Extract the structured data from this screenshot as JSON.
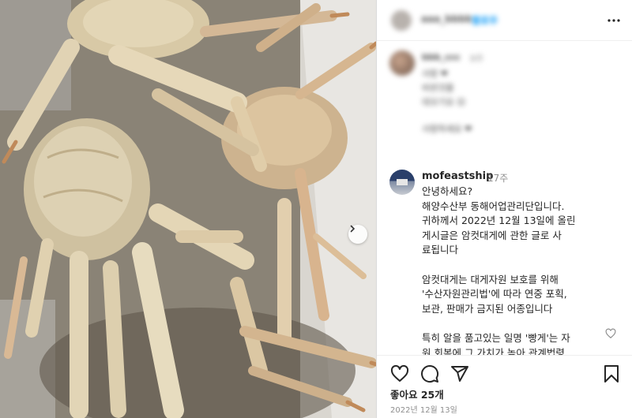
{
  "post": {
    "header": {
      "username": "aaa_bbbb",
      "follow_label": "팔로우"
    },
    "icons": {
      "more": "more-horizontal-icon",
      "next": "chevron-right-icon",
      "like": "heart-icon",
      "comment": "comment-icon",
      "share": "share-icon",
      "save": "bookmark-icon"
    },
    "blurred_comment": {
      "username": "bbb_ccc",
      "time": "8주",
      "lines": [
        "사랑 ❤",
        "비싼것을",
        "대꼬기요 😊",
        "사랑하세요 ❤"
      ]
    },
    "comment": {
      "username": "mofeastship",
      "time": "17주",
      "lines": [
        "안녕하세요?",
        "해양수산부 동해어업관리단입니다.",
        "귀하께서 2022년 12월 13일에 올린",
        "게시글은 암컷대게에 관한 글로 사",
        "료됩니다",
        "",
        "암컷대게는 대게자원 보호를 위해",
        "'수산자원관리법'에 따라 연중 포획,",
        "보관, 판매가 금지된 어종입니다",
        "",
        "특히 알을 품고있는 일명 '빵게'는 자",
        "원 회복에 그 가치가 높아 관계법령"
      ]
    },
    "likes_text": "좋아요 25개",
    "date_text": "2022년 12월 13일"
  },
  "colors": {
    "link_blue": "#0095f6",
    "muted": "#8e8e8e",
    "text": "#262626",
    "heart": "#ed4956"
  }
}
